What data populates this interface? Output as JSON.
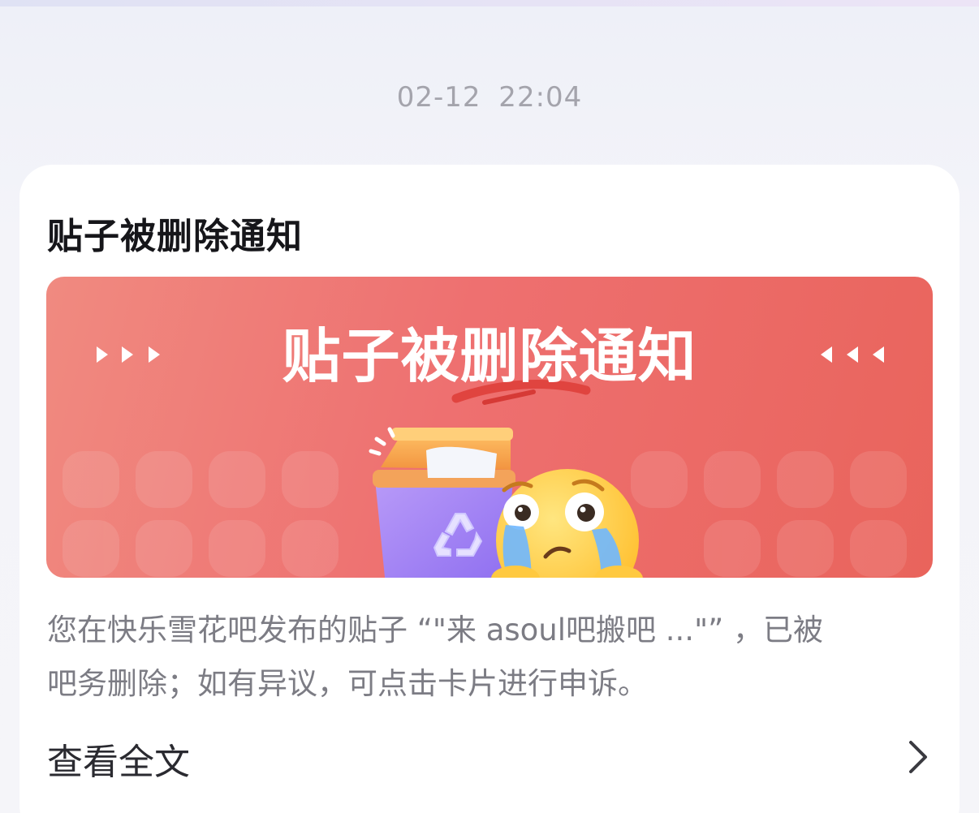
{
  "timestamp": "02-12  22:04",
  "card": {
    "title": "贴子被删除通知",
    "banner": {
      "heading": "贴子被删除通知",
      "illustration": [
        "recycle-bin-icon",
        "crying-face-icon"
      ]
    },
    "message_line1": "您在快乐雪花吧发布的贴子 “\"来 asoul吧搬吧 ...\"” ，已被",
    "message_line2": "吧务删除；如有异议，可点击卡片进行申诉。",
    "read_more_label": "查看全文",
    "read_more_icon": "chevron-right-icon"
  },
  "colors": {
    "banner_start": "#f08a80",
    "banner_end": "#e9645c",
    "bin_body": "#a98af5",
    "bin_lid": "#f5a24d",
    "face": "#ffd24a"
  }
}
